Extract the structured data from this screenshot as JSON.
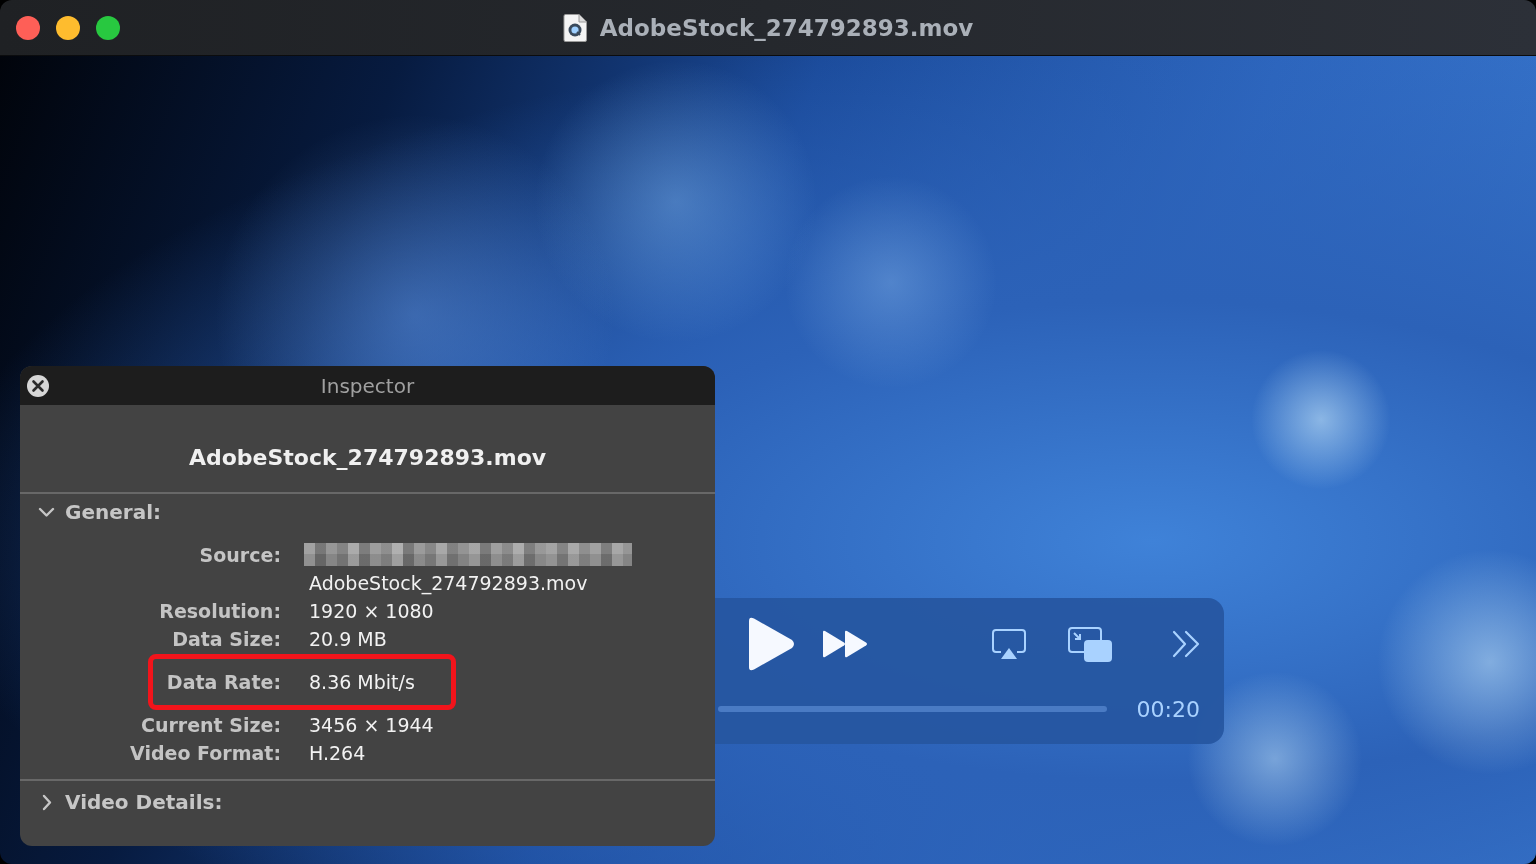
{
  "window": {
    "title": "AdobeStock_274792893.mov"
  },
  "player_controls": {
    "time": "00:20"
  },
  "inspector": {
    "title": "Inspector",
    "file_name": "AdobeStock_274792893.mov",
    "sections": [
      {
        "title": "General:",
        "expanded": true,
        "rows": [
          {
            "label": "Source:",
            "value": "AdobeStock_274792893.mov",
            "redacted": true,
            "highlighted": false
          },
          {
            "label": "Resolution:",
            "value": "1920 × 1080",
            "redacted": false,
            "highlighted": false
          },
          {
            "label": "Data Size:",
            "value": "20.9 MB",
            "redacted": false,
            "highlighted": false
          },
          {
            "label": "Data Rate:",
            "value": "8.36 Mbit/s",
            "redacted": false,
            "highlighted": true
          },
          {
            "label": "Current Size:",
            "value": "3456 × 1944",
            "redacted": false,
            "highlighted": false
          },
          {
            "label": "Video Format:",
            "value": "H.264",
            "redacted": false,
            "highlighted": false
          }
        ]
      },
      {
        "title": "Video Details:",
        "expanded": false
      }
    ]
  }
}
